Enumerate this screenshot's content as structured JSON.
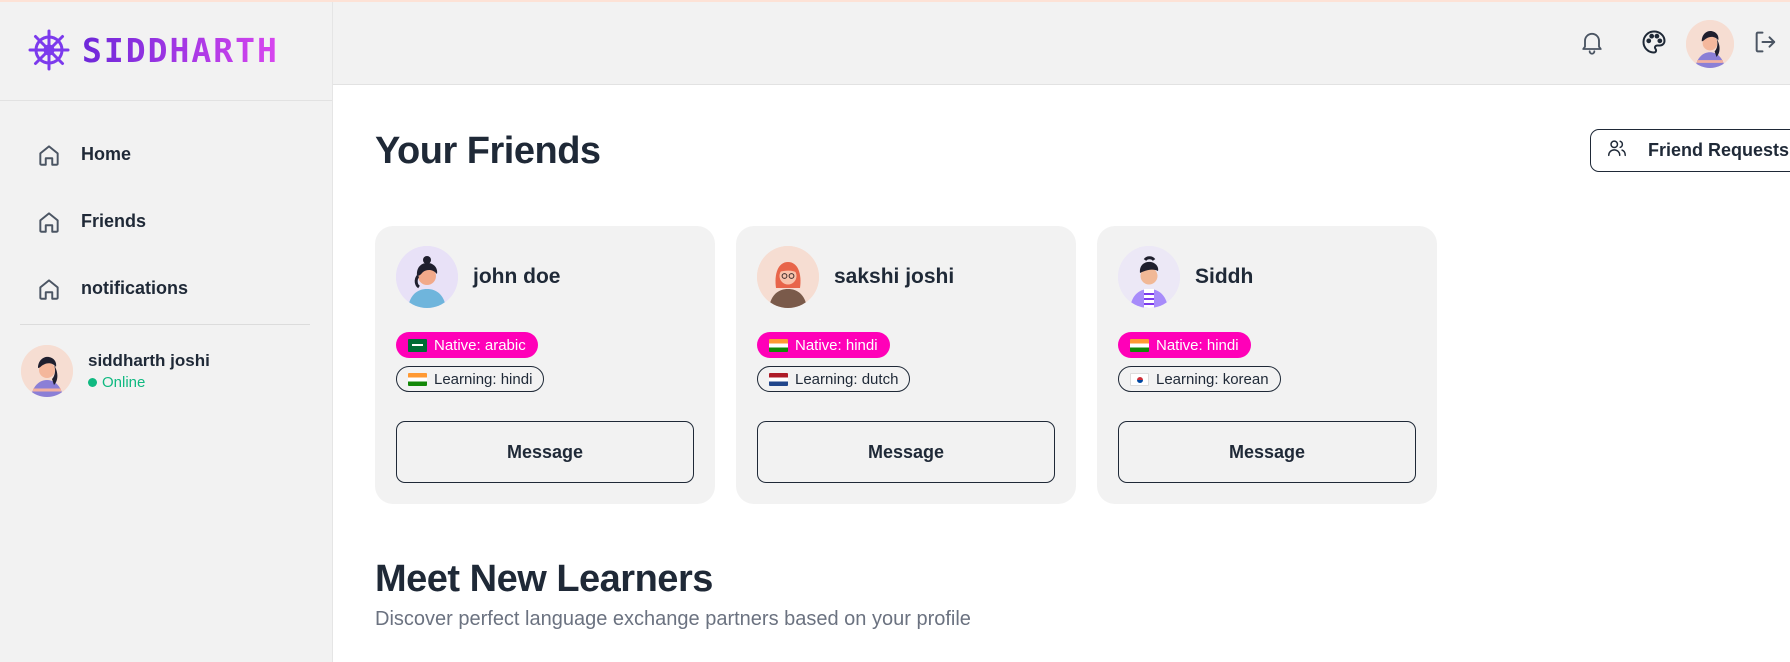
{
  "brand": {
    "name": "SIDDHARTH",
    "icon": "ship-wheel-icon",
    "color": "#7c3aed"
  },
  "sidebar": {
    "items": [
      {
        "label": "Home",
        "icon": "home-icon"
      },
      {
        "label": "Friends",
        "icon": "home-icon"
      },
      {
        "label": "notifications",
        "icon": "home-icon"
      }
    ],
    "user": {
      "name": "siddharth joshi",
      "status": "Online"
    }
  },
  "header": {
    "icons": [
      "bell-icon",
      "palette-icon",
      "avatar",
      "logout-icon"
    ]
  },
  "main": {
    "title": "Your Friends",
    "friend_requests_label": "Friend Requests",
    "friends": [
      {
        "name": "john doe",
        "native": "Native: arabic",
        "learning": "Learning: hindi",
        "native_flag": "sa",
        "learning_flag": "in",
        "message_label": "Message"
      },
      {
        "name": "sakshi joshi",
        "native": "Native: hindi",
        "learning": "Learning: dutch",
        "native_flag": "in",
        "learning_flag": "nl",
        "message_label": "Message"
      },
      {
        "name": "Siddh",
        "native": "Native: hindi",
        "learning": "Learning: korean",
        "native_flag": "in",
        "learning_flag": "kr",
        "message_label": "Message"
      }
    ],
    "section_title": "Meet New Learners",
    "section_subtitle": "Discover perfect language exchange partners based on your profile"
  },
  "colors": {
    "native_badge": "#ff00b8",
    "online": "#10b981",
    "text": "#1f2937"
  }
}
